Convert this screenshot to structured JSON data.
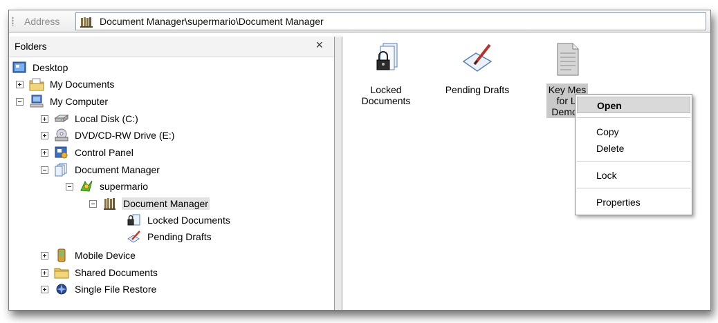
{
  "address": {
    "label": "Address",
    "path": "Document Manager\\supermario\\Document Manager"
  },
  "folders": {
    "title": "Folders",
    "close_glyph": "×",
    "tree": [
      {
        "label": "Desktop"
      },
      {
        "label": "My Documents"
      },
      {
        "label": "My Computer"
      },
      {
        "label": "Local Disk (C:)"
      },
      {
        "label": "DVD/CD-RW Drive (E:)"
      },
      {
        "label": "Control Panel"
      },
      {
        "label": "Document Manager"
      },
      {
        "label": "supermario"
      },
      {
        "label": "Document Manager"
      },
      {
        "label": "Locked Documents"
      },
      {
        "label": "Pending Drafts"
      },
      {
        "label": "Mobile Device"
      },
      {
        "label": "Shared Documents"
      },
      {
        "label": "Single File Restore"
      }
    ]
  },
  "content": {
    "items": [
      {
        "line1": "Locked",
        "line2": "Documents"
      },
      {
        "line1": "Pending Drafts"
      },
      {
        "line1": "Key Mes",
        "line2": "for L'",
        "line3": "Demo_"
      }
    ]
  },
  "context_menu": {
    "items": [
      "Open",
      "Copy",
      "Delete",
      "Lock",
      "Properties"
    ]
  }
}
